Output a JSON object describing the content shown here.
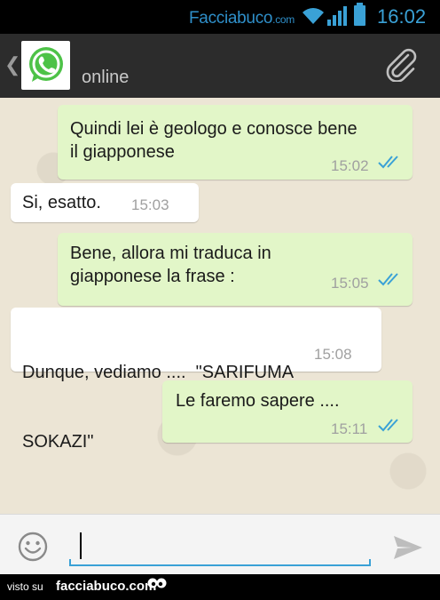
{
  "status_bar": {
    "watermark": "Facciabuco",
    "watermark_suffix": ".com",
    "time": "16:02",
    "icons": [
      "wifi-icon",
      "signal-icon",
      "battery-icon"
    ]
  },
  "header": {
    "back_icon": "chevron-left-icon",
    "avatar_icon": "whatsapp-logo-icon",
    "status": "online",
    "attach_icon": "paperclip-icon"
  },
  "messages": [
    {
      "direction": "out",
      "lines": [
        "Quindi lei è geologo e conosce bene",
        "il giapponese"
      ],
      "time": "15:02",
      "status": "read"
    },
    {
      "direction": "in",
      "lines": [
        "Si, esatto."
      ],
      "time": "15:03"
    },
    {
      "direction": "out",
      "lines": [
        "Bene, allora mi traduca in",
        "giapponese la frase :"
      ],
      "time": "15:05",
      "status": "read"
    },
    {
      "direction": "in",
      "lines": [
        "Dunque, vediamo ....  \"SARIFUMA",
        "SOKAZI\""
      ],
      "time": "15:08"
    },
    {
      "direction": "out",
      "lines": [
        "Le faremo sapere ...."
      ],
      "time": "15:11",
      "status": "read"
    }
  ],
  "input_bar": {
    "emoji_icon": "smiley-icon",
    "value": "",
    "send_icon": "send-arrow-icon"
  },
  "footer": {
    "visto": "visto su",
    "brand": "facciabuco.com"
  },
  "colors": {
    "accent": "#3aa1d6",
    "outgoing_bubble": "#e2f6c8",
    "incoming_bubble": "#ffffff",
    "chat_background": "#ece5d5"
  }
}
